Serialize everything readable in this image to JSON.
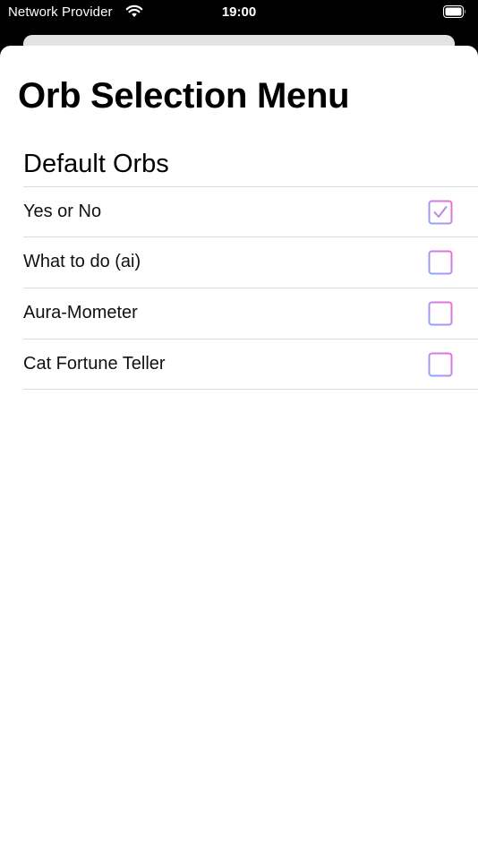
{
  "status_bar": {
    "carrier": "Network Provider",
    "time": "19:00",
    "wifi_icon": "wifi-icon",
    "battery_icon": "battery-full-icon"
  },
  "sheet": {
    "title": "Orb Selection Menu",
    "section_header": "Default Orbs",
    "orbs": [
      {
        "label": "Yes or No",
        "selected": true
      },
      {
        "label": "What to do (ai)",
        "selected": false
      },
      {
        "label": "Aura-Mometer",
        "selected": false
      },
      {
        "label": "Cat Fortune Teller",
        "selected": false
      }
    ]
  },
  "colors": {
    "checkbox_gradient_start": "#f06ad6",
    "checkbox_gradient_end": "#8aa8ff",
    "checkmark": "#b887f0"
  }
}
